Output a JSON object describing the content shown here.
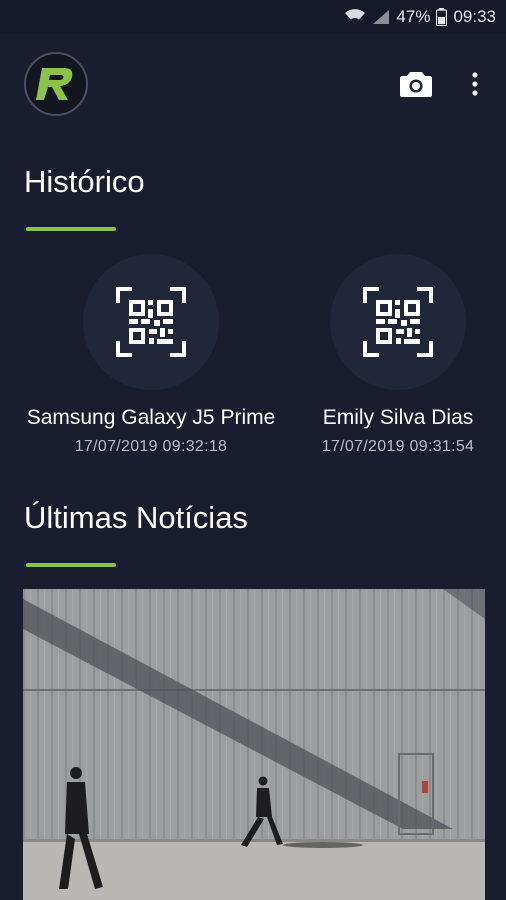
{
  "status_bar": {
    "battery": "47%",
    "time": "09:33",
    "icons": [
      "wifi-icon",
      "signal-icon",
      "battery-icon"
    ]
  },
  "app_bar": {
    "logo_letter": "R",
    "actions": [
      "camera-icon",
      "more-vert-icon"
    ]
  },
  "history": {
    "title": "Histórico",
    "items": [
      {
        "name": "Samsung Galaxy J5 Prime",
        "date": "17/07/2019 09:32:18",
        "icon": "qr-code-icon"
      },
      {
        "name": "Emily Silva Dias",
        "date": "17/07/2019 09:31:54",
        "icon": "qr-code-icon"
      }
    ]
  },
  "news": {
    "title": "Últimas Notícias",
    "image": "news-photo"
  },
  "colors": {
    "background": "#1a1d2e",
    "accent": "#8bc34a",
    "circle": "#222639"
  }
}
